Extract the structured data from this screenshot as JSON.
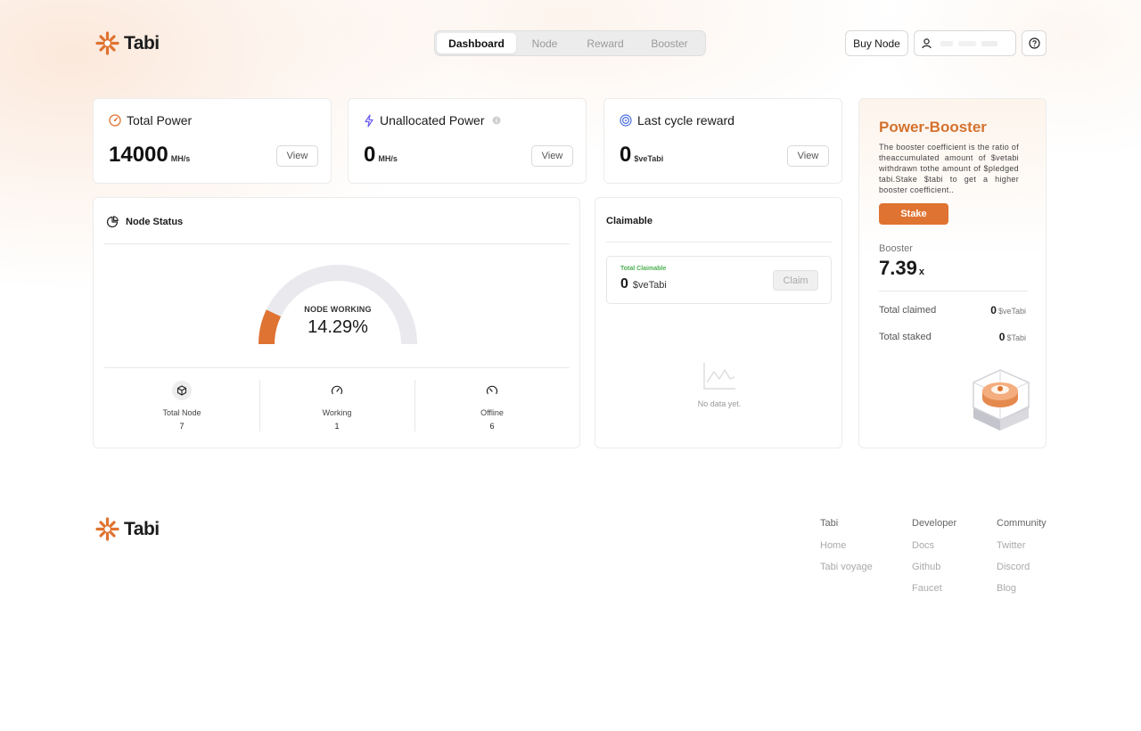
{
  "brand": {
    "name": "Tabi",
    "accent": "#df7331"
  },
  "header": {
    "tabs": [
      {
        "label": "Dashboard",
        "active": true
      },
      {
        "label": "Node",
        "active": false
      },
      {
        "label": "Reward",
        "active": false
      },
      {
        "label": "Booster",
        "active": false
      }
    ],
    "buy_node_label": "Buy Node",
    "user_icon": "user-icon",
    "help_icon": "help-icon"
  },
  "stats": {
    "total_power": {
      "title": "Total Power",
      "value": "14000",
      "unit": "MH/s",
      "button": "View",
      "icon": "power-meter-icon"
    },
    "unallocated_power": {
      "title": "Unallocated Power",
      "value": "0",
      "unit": "MH/s",
      "button": "View",
      "icon": "lightning-icon",
      "info_icon": "info-icon"
    },
    "last_cycle_reward": {
      "title": "Last cycle reward",
      "value": "0",
      "unit": "$veTabi",
      "button": "View",
      "icon": "target-icon"
    }
  },
  "node_status": {
    "title": "Node Status",
    "gauge_label": "NODE WORKING",
    "gauge_value": "14.29%",
    "gauge_fraction": 0.1429,
    "items": [
      {
        "label": "Total Node",
        "value": "7",
        "icon": "cube-icon"
      },
      {
        "label": "Working",
        "value": "1",
        "icon": "speedometer-icon"
      },
      {
        "label": "Offline",
        "value": "6",
        "icon": "speedometer-low-icon"
      }
    ]
  },
  "claimable": {
    "title": "Claimable",
    "total_label": "Total Claimable",
    "value": "0",
    "unit": "$veTabi",
    "claim_label": "Claim",
    "empty_text": "No data yet."
  },
  "booster": {
    "title": "Power-Booster",
    "description": "The booster coefficient is the ratio of theaccumulated amount of $vetabi withdrawn tothe amount of $pledged tabi.Stake $tabi to get a higher booster coefficient..",
    "stake_label": "Stake",
    "booster_label": "Booster",
    "booster_value": "7.39",
    "booster_suffix": "x",
    "total_claimed_label": "Total claimed",
    "total_claimed_value": "0",
    "total_claimed_unit": "$veTabi",
    "total_staked_label": "Total staked",
    "total_staked_value": "0",
    "total_staked_unit": "$Tabi"
  },
  "footer": {
    "columns": [
      {
        "heading": "Tabi",
        "links": [
          "Home",
          "Tabi voyage"
        ]
      },
      {
        "heading": "Developer",
        "links": [
          "Docs",
          "Github",
          "Faucet"
        ]
      },
      {
        "heading": "Community",
        "links": [
          "Twitter",
          "Discord",
          "Blog"
        ]
      }
    ]
  }
}
